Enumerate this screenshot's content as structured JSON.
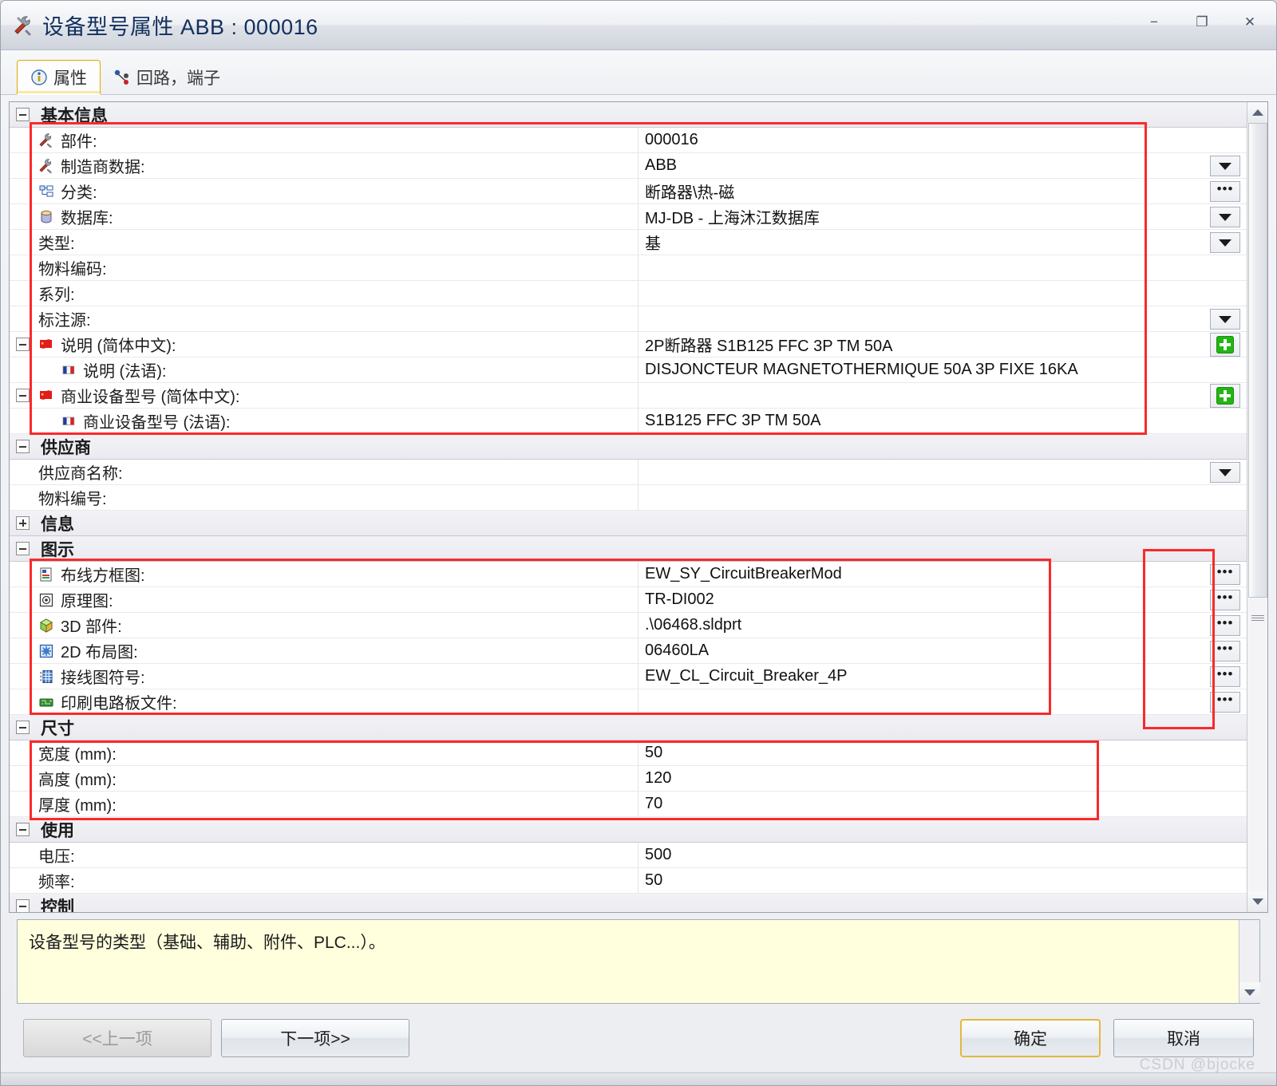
{
  "window": {
    "title": "设备型号属性 ABB : 000016",
    "title_icon": "tools-icon",
    "minimize_label": "−",
    "maximize_label": "❐",
    "close_label": "✕"
  },
  "tabs": [
    {
      "label": "属性",
      "icon": "info-icon",
      "active": true
    },
    {
      "label": "回路，端子",
      "icon": "circuit-icon",
      "active": false
    }
  ],
  "groups": [
    {
      "name": "基本信息",
      "expanded": true,
      "rows": [
        {
          "label": "部件:",
          "value": "000016",
          "icon": "tools-icon",
          "editor": "none"
        },
        {
          "label": "制造商数据:",
          "value": "ABB",
          "icon": "tools-icon",
          "editor": "dropdown"
        },
        {
          "label": "分类:",
          "value": "断路器\\热-磁",
          "icon": "tree-icon",
          "editor": "ellipsis"
        },
        {
          "label": "数据库:",
          "value": "MJ-DB - 上海沐江数据库",
          "icon": "database-icon",
          "editor": "dropdown"
        },
        {
          "label": "类型:",
          "value": "基",
          "icon": "none",
          "editor": "dropdown"
        },
        {
          "label": "物料编码:",
          "value": "",
          "icon": "none",
          "editor": "none"
        },
        {
          "label": "系列:",
          "value": "",
          "icon": "none",
          "editor": "none"
        },
        {
          "label": "标注源:",
          "value": "",
          "icon": "none",
          "editor": "dropdown"
        },
        {
          "label": "说明 (简体中文):",
          "value": "2P断路器  S1B125 FFC 3P TM 50A",
          "icon": "flag-cn-icon",
          "editor": "plus",
          "expander": true
        },
        {
          "label": "说明 (法语):",
          "value": "DISJONCTEUR MAGNETOTHERMIQUE 50A 3P FIXE 16KA",
          "icon": "flag-fr-icon",
          "editor": "none",
          "indent": true
        },
        {
          "label": "商业设备型号 (简体中文):",
          "value": "",
          "icon": "flag-cn-icon",
          "editor": "plus",
          "expander": true
        },
        {
          "label": "商业设备型号 (法语):",
          "value": "S1B125 FFC 3P TM 50A",
          "icon": "flag-fr-icon",
          "editor": "none",
          "indent": true
        }
      ]
    },
    {
      "name": "供应商",
      "expanded": true,
      "rows": [
        {
          "label": "供应商名称:",
          "value": "",
          "icon": "none",
          "editor": "dropdown"
        },
        {
          "label": "物料编号:",
          "value": "",
          "icon": "none",
          "editor": "none"
        }
      ]
    },
    {
      "name": "信息",
      "expanded": false,
      "rows": []
    },
    {
      "name": "图示",
      "expanded": true,
      "rows": [
        {
          "label": "布线方框图:",
          "value": "EW_SY_CircuitBreakerMod",
          "icon": "blockdiagram-icon",
          "editor": "ellipsis"
        },
        {
          "label": "原理图:",
          "value": "TR-DI002",
          "icon": "schematic-icon",
          "editor": "ellipsis"
        },
        {
          "label": "3D 部件:",
          "value": ".\\06468.sldprt",
          "icon": "cube3d-icon",
          "editor": "ellipsis"
        },
        {
          "label": "2D 布局图:",
          "value": "06460LA",
          "icon": "layout2d-icon",
          "editor": "ellipsis"
        },
        {
          "label": "接线图符号:",
          "value": "EW_CL_Circuit_Breaker_4P",
          "icon": "wiring-icon",
          "editor": "ellipsis"
        },
        {
          "label": "印刷电路板文件:",
          "value": "",
          "icon": "pcb-icon",
          "editor": "ellipsis"
        }
      ]
    },
    {
      "name": "尺寸",
      "expanded": true,
      "rows": [
        {
          "label": "宽度 (mm):",
          "value": "50",
          "icon": "none",
          "editor": "none"
        },
        {
          "label": "高度 (mm):",
          "value": "120",
          "icon": "none",
          "editor": "none"
        },
        {
          "label": "厚度 (mm):",
          "value": "70",
          "icon": "none",
          "editor": "none"
        }
      ]
    },
    {
      "name": "使用",
      "expanded": true,
      "rows": [
        {
          "label": "电压:",
          "value": "500",
          "icon": "none",
          "editor": "none"
        },
        {
          "label": "频率:",
          "value": "50",
          "icon": "none",
          "editor": "none"
        }
      ]
    },
    {
      "name": "控制",
      "expanded": true,
      "rows": []
    }
  ],
  "description_pane": {
    "text": "设备型号的类型（基础、辅助、附件、PLC...）。"
  },
  "footer": {
    "prev_label": "<<上一项",
    "next_label": "下一项>>",
    "ok_label": "确定",
    "cancel_label": "取消",
    "watermark": "CSDN @bjocke"
  },
  "colors": {
    "annotation_red": "#fa2a2a",
    "tab_accent": "#e0a800",
    "ok_accent": "#e2b93c",
    "plus_green": "#22b514",
    "title_text": "#11305e",
    "desc_bg": "#ffffdd"
  }
}
